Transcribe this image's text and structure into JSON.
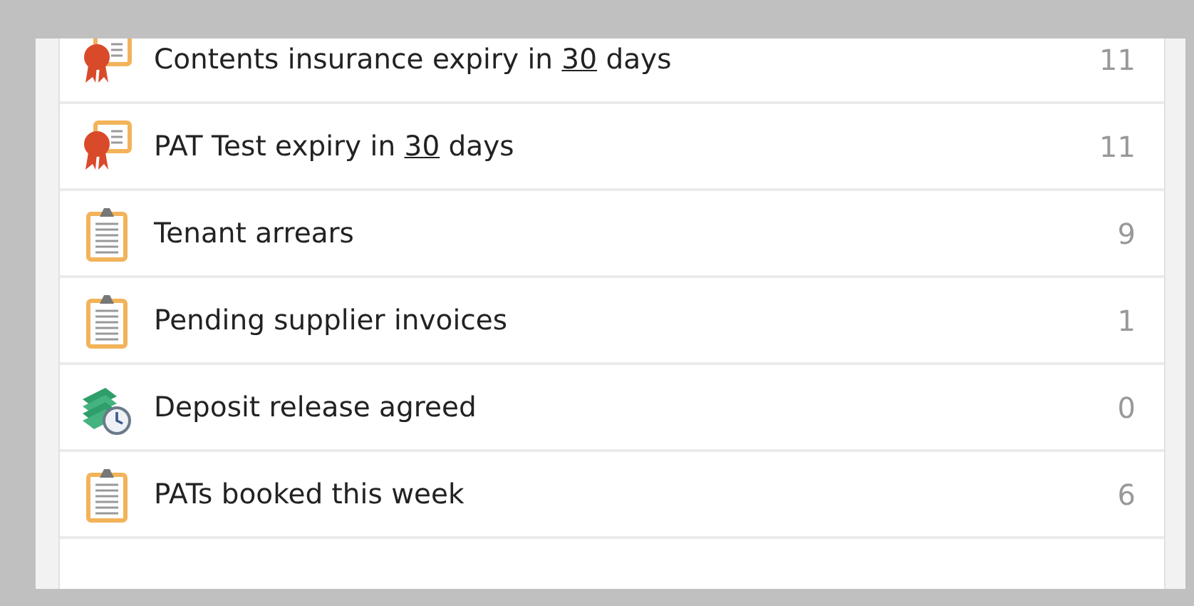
{
  "rows": [
    {
      "kind": "certificate",
      "text": "Contents insurance expiry in ",
      "underlined": "30",
      "text_after": " days",
      "count": "11"
    },
    {
      "kind": "certificate",
      "text": "PAT Test expiry in ",
      "underlined": "30",
      "text_after": " days",
      "count": "11"
    },
    {
      "kind": "clipboard",
      "text": "Tenant arrears",
      "count": "9"
    },
    {
      "kind": "clipboard",
      "text": "Pending supplier invoices",
      "count": "1"
    },
    {
      "kind": "money-clock",
      "text": "Deposit release agreed",
      "count": "0"
    },
    {
      "kind": "clipboard",
      "text": "PATs booked this week",
      "count": "6"
    }
  ]
}
